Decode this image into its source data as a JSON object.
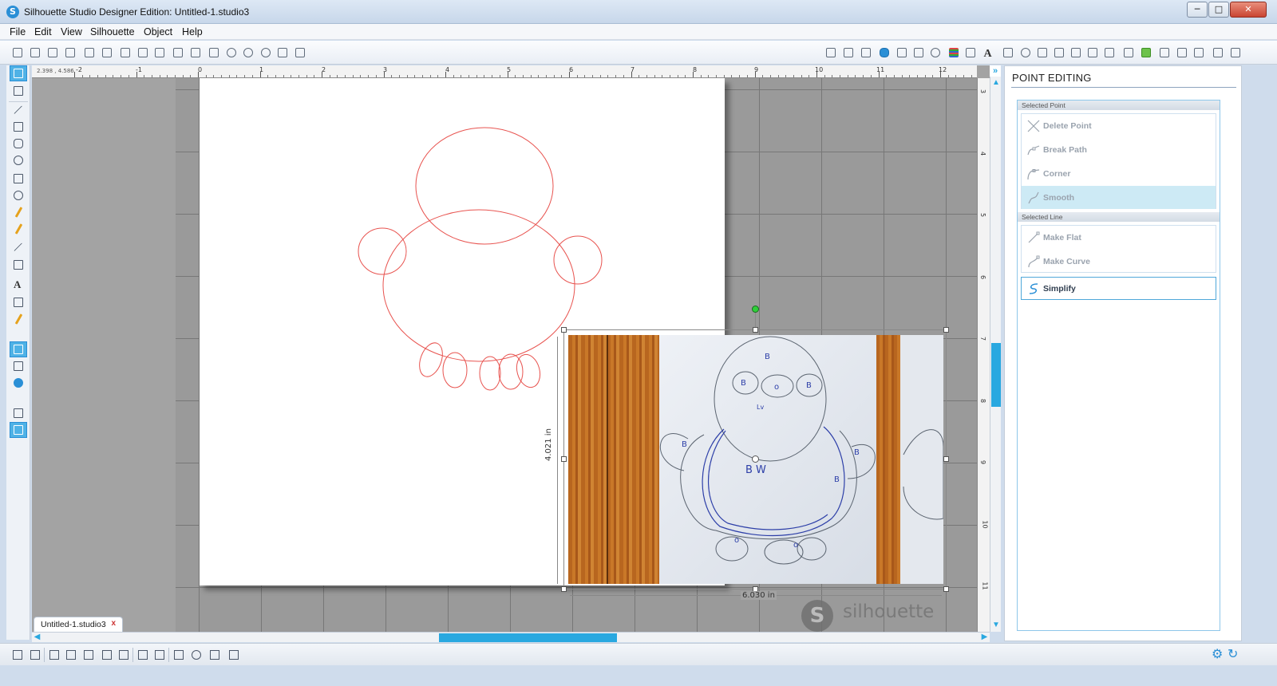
{
  "window": {
    "title": "Silhouette Studio Designer Edition: Untitled-1.studio3",
    "app_icon": "S",
    "minimize_label": "─",
    "maximize_label": "□",
    "close_label": "✕"
  },
  "menu": {
    "items": [
      "File",
      "Edit",
      "View",
      "Silhouette",
      "Object",
      "Help"
    ]
  },
  "toolbar": {
    "text_tool_glyph": "A"
  },
  "left_tools": {
    "text_tool_glyph": "A"
  },
  "ruler": {
    "coords": "2.398 , 4.586",
    "top_labels": [
      "-2",
      "-1",
      "0",
      "1",
      "2",
      "3",
      "4",
      "5",
      "6",
      "7",
      "8",
      "9",
      "10",
      "11",
      "12"
    ],
    "right_labels": [
      "3",
      "4",
      "5",
      "6",
      "7",
      "8",
      "9",
      "10",
      "11"
    ]
  },
  "canvas": {
    "height_dimension": "4.021 in",
    "width_dimension": "6.030 in",
    "photo_labels": [
      "B",
      "B",
      "o",
      "B",
      "Lv",
      "B",
      "B W",
      "B",
      "B",
      "o",
      "o"
    ]
  },
  "watermark": {
    "logo_letter": "S",
    "text": "silhouette"
  },
  "document_tab": {
    "label": "Untitled-1.studio3",
    "close_glyph": "x"
  },
  "scroll": {
    "left_arrow": "◀",
    "right_arrow": "▶",
    "up_arrow": "▲",
    "down_arrow": "▼",
    "collapse_glyph": "»"
  },
  "panel": {
    "title": "POINT EDITING",
    "selected_point_header": "Selected Point",
    "selected_line_header": "Selected Line",
    "point_items": [
      "Delete Point",
      "Break Path",
      "Corner",
      "Smooth"
    ],
    "line_items": [
      "Make Flat",
      "Make Curve"
    ],
    "simplify_label": "Simplify",
    "selected_item": "Smooth"
  },
  "bottom": {
    "gear_glyph": "⚙",
    "refresh_glyph": "↻"
  },
  "colors": {
    "accent": "#29a8e0",
    "sketch_line": "#e8534f",
    "pen_blue": "#2d3fa8"
  }
}
